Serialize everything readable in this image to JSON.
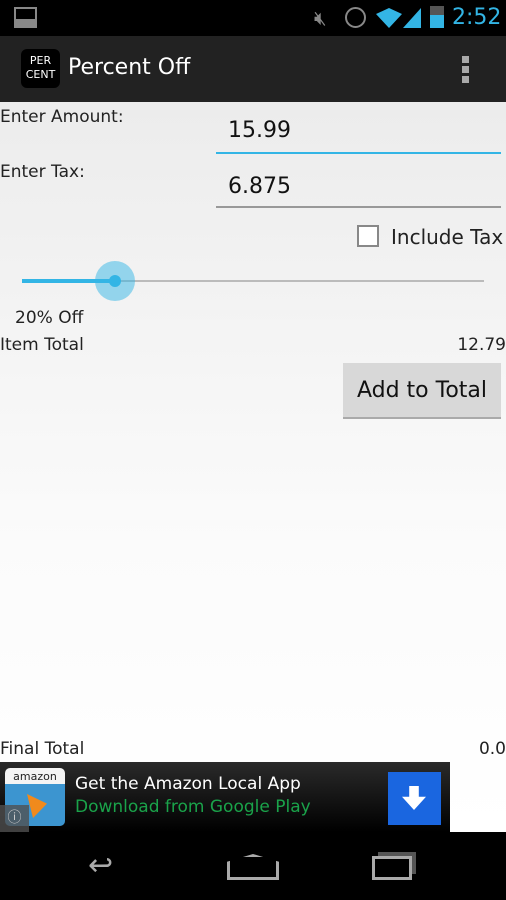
{
  "status_bar": {
    "time": "2:52",
    "icons": [
      "image-icon",
      "mute-icon",
      "alarm-icon",
      "wifi-icon",
      "signal-icon",
      "battery-icon"
    ]
  },
  "action_bar": {
    "logo_line1": "PER",
    "logo_line2": "CENT",
    "title": "Percent Off",
    "overflow_icon": "overflow-menu-icon"
  },
  "form": {
    "amount_label": "Enter Amount:",
    "amount_value": "15.99",
    "tax_label": "Enter Tax:",
    "tax_value": "6.875",
    "include_tax_label": "Include Tax",
    "include_tax_checked": false,
    "slider_percent": 20,
    "slider_label": "20% Off",
    "item_total_label": "Item Total",
    "item_total_value": "12.79",
    "add_button": "Add to Total",
    "final_total_label": "Final Total",
    "final_total_value": "0.0"
  },
  "ad": {
    "brand": "amazon",
    "title": "Get the Amazon Local App",
    "subtitle": "Download from Google Play",
    "accent": "#1a66e0",
    "subtitle_color": "#1aa34a"
  },
  "colors": {
    "accent": "#33b5e5"
  }
}
